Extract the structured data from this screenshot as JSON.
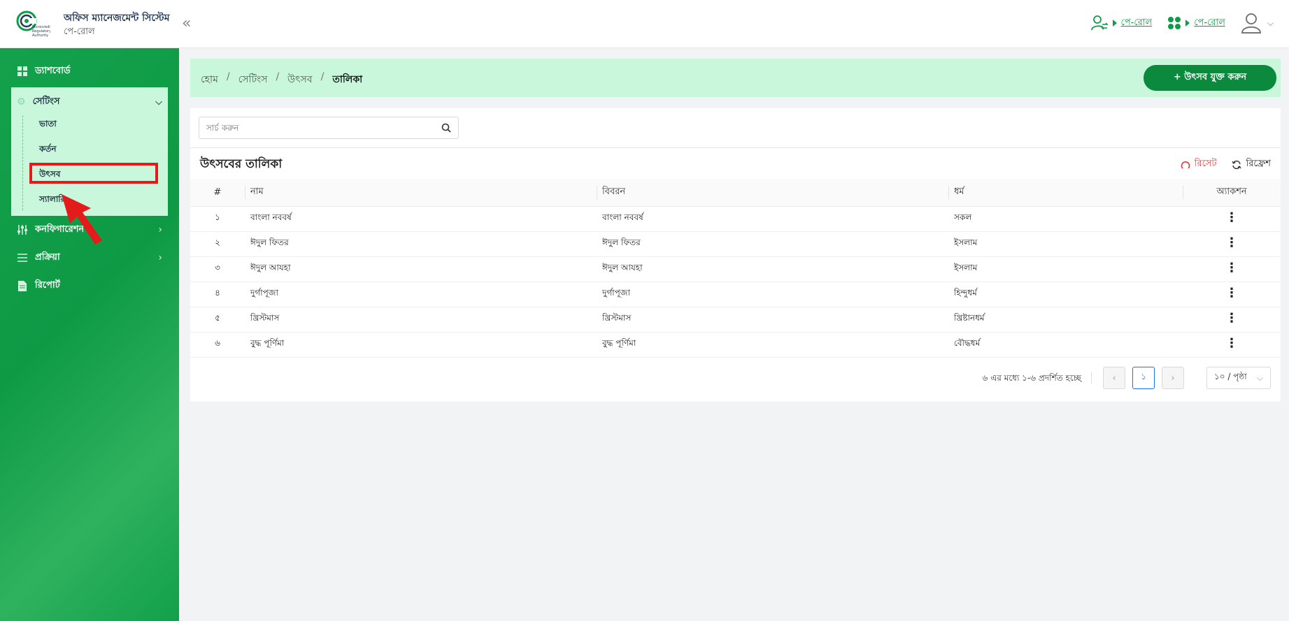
{
  "header": {
    "title": "অফিস ম্যানেজমেন্ট সিস্টেম",
    "subtitle": "পে-রোল",
    "logo_text": "Microcredit Regulatory Authority",
    "links": [
      {
        "label": "পে-রোল",
        "icon": "user-swap-icon"
      },
      {
        "label": "পে-রোল",
        "icon": "apps-grid-icon"
      }
    ],
    "brand_color": "#0f9b48"
  },
  "sidebar": {
    "dashboard": "ড্যাশবোর্ড",
    "settings": "সেটিংস",
    "sub_items": [
      "ভাতা",
      "কর্তন",
      "উৎসব",
      "স্যালারি"
    ],
    "configuration": "কনফিগারেশন",
    "process": "প্রক্রিয়া",
    "report": "রিপোর্ট",
    "selected": "উৎসব"
  },
  "breadcrumb": {
    "items": [
      "হোম",
      "সেটিংস",
      "উৎসব"
    ],
    "current": "তালিকা"
  },
  "add_button": "+ উৎসব যুক্ত করুন",
  "search": {
    "placeholder": "সার্চ করুন"
  },
  "list": {
    "title": "উৎসবের তালিকা",
    "reset": "রিসেট",
    "refresh": "রিফ্রেশ"
  },
  "table": {
    "headers": [
      "#",
      "নাম",
      "বিবরন",
      "ধর্ম",
      "অ্যাকশন"
    ],
    "rows": [
      {
        "num": "১",
        "name": "বাংলা নববর্ষ",
        "desc": "বাংলা নববর্ষ",
        "religion": "সকল"
      },
      {
        "num": "২",
        "name": "ঈদুল ফিতর",
        "desc": "ঈদুল ফিতর",
        "religion": "ইসলাম"
      },
      {
        "num": "৩",
        "name": "ঈদুল আযহা",
        "desc": "ঈদুল আযহা",
        "religion": "ইসলাম"
      },
      {
        "num": "৪",
        "name": "দুর্গাপূজা",
        "desc": "দুর্গাপূজা",
        "religion": "হিন্দুধর্ম"
      },
      {
        "num": "৫",
        "name": "খ্রিস্টমাস",
        "desc": "খ্রিস্টমাস",
        "religion": "খ্রিষ্টানধর্ম"
      },
      {
        "num": "৬",
        "name": "বুদ্ধ পূর্ণিমা",
        "desc": "বুদ্ধ পূর্ণিমা",
        "religion": "বৌদ্ধধর্ম"
      }
    ]
  },
  "pagination": {
    "info": "৬ এর মধ্যে ১-৬ প্রদর্শিত হচ্ছে",
    "current_page": "১",
    "page_size": "১০ / পৃষ্ঠা"
  },
  "colors": {
    "accent": "#0b8a3e",
    "breadcrumb_bg": "#c9f7dc",
    "reset": "#e53935",
    "highlight": "#e31b1b"
  }
}
